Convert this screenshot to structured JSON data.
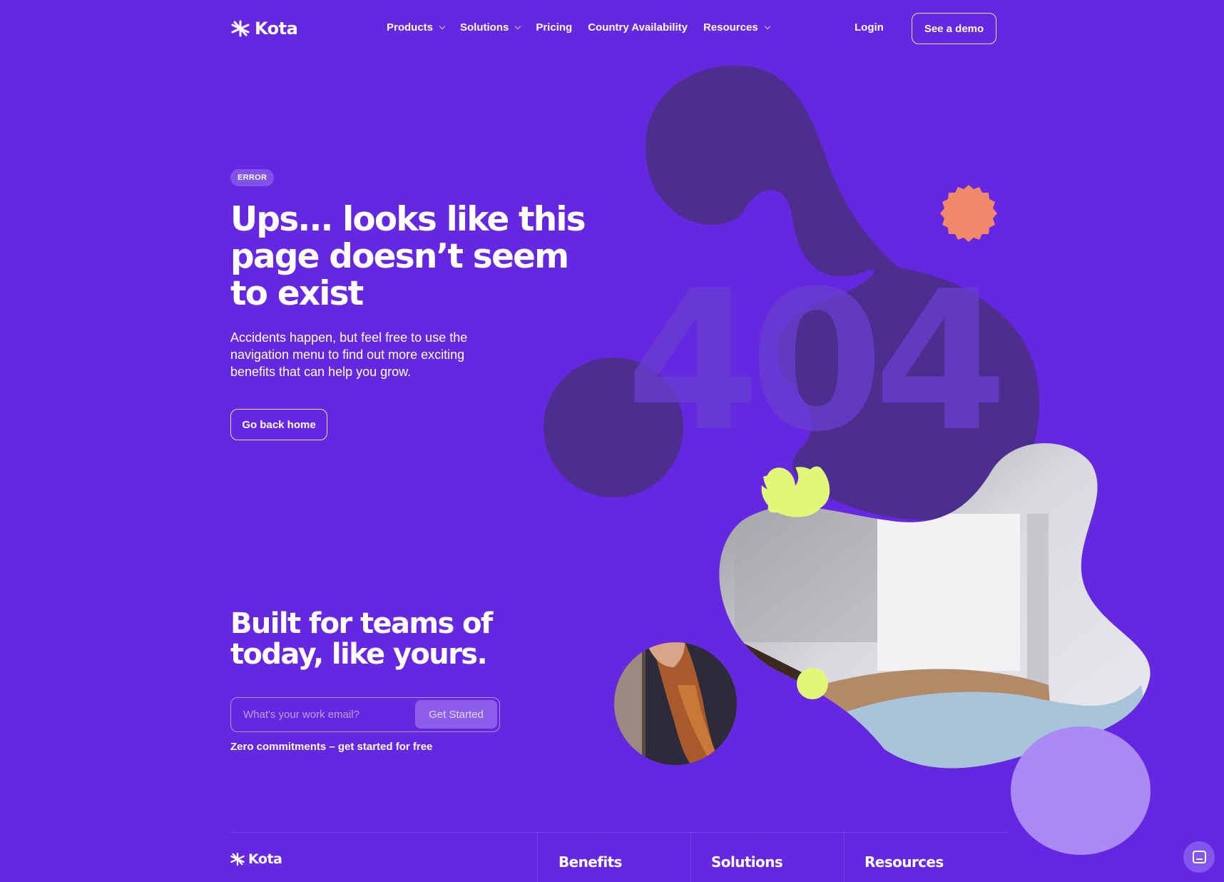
{
  "brand": {
    "name": "Kota"
  },
  "nav": {
    "items": [
      {
        "label": "Products",
        "dropdown": true
      },
      {
        "label": "Solutions",
        "dropdown": true
      },
      {
        "label": "Pricing",
        "dropdown": false
      },
      {
        "label": "Country Availability",
        "dropdown": false
      },
      {
        "label": "Resources",
        "dropdown": true
      }
    ],
    "login": "Login",
    "demo": "See a demo"
  },
  "hero": {
    "badge": "ERROR",
    "title": "Ups... looks like this page doesn’t seem to exist",
    "subtitle": "Accidents happen, but feel free to use the navigation menu to find out more exciting benefits that can help you grow.",
    "button": "Go back home",
    "big_number": "404"
  },
  "signup": {
    "title": "Built for teams of today, like yours.",
    "placeholder": "What's your work email?",
    "button": "Get Started",
    "note": "Zero commitments – get started for free"
  },
  "footer": {
    "logo": "Kota",
    "columns": [
      "Benefits",
      "Solutions",
      "Resources"
    ]
  },
  "icons": {
    "logo": "asterisk-burst-icon",
    "chevron": "chevron-down-icon",
    "chat": "chat-bubble-icon"
  },
  "colors": {
    "background": "#6627E0",
    "blob": "#4C2E8E",
    "orange_badge": "#F0896A",
    "lime": "#E2F77A",
    "lavender": "#A98AF4"
  }
}
